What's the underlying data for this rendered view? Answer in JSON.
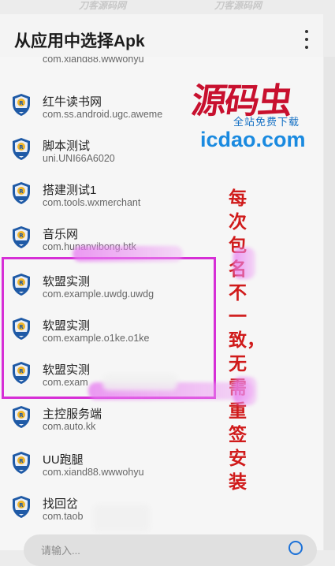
{
  "watermark_top": [
    "刀客源码网",
    "刀客源码网"
  ],
  "header": {
    "title": "从应用中选择Apk",
    "more_icon": "more-vert-icon"
  },
  "apps": [
    {
      "name": "",
      "package": "com.xiand88.wwwohyu",
      "icon": "wechat-icon"
    },
    {
      "name": "红牛读书网",
      "package": "com.ss.android.ugc.aweme",
      "icon": "ruanmeng-shield-icon"
    },
    {
      "name": "脚本测试",
      "package": "uni.UNI66A6020",
      "icon": "ruanmeng-shield-icon"
    },
    {
      "name": "搭建测试1",
      "package": "com.tools.wxmerchant",
      "icon": "ruanmeng-shield-icon"
    },
    {
      "name": "音乐网",
      "package": "com.hunanvibong.btk",
      "icon": "ruanmeng-shield-icon"
    },
    {
      "name": "软盟实测",
      "package": "com.example.uwdg.uwdg",
      "icon": "ruanmeng-shield-icon"
    },
    {
      "name": "软盟实测",
      "package": "com.example.o1ke.o1ke",
      "icon": "ruanmeng-shield-icon"
    },
    {
      "name": "软盟实测",
      "package": "com.exam",
      "icon": "ruanmeng-shield-icon"
    },
    {
      "name": "主控服务端",
      "package": "com.auto.kk",
      "icon": "ruanmeng-shield-icon"
    },
    {
      "name": "UU跑腿",
      "package": "com.xiand88.wwwohyu",
      "icon": "ruanmeng-shield-icon"
    },
    {
      "name": "找回岔",
      "package": "com.taob",
      "icon": "ruanmeng-shield-icon"
    }
  ],
  "overlay": {
    "logo_text": "源码虫",
    "logo_sub": "全站免费下载",
    "logo_url": "icdao.com",
    "vertical_note": "每次包名不一致，无需重签安装"
  },
  "search": {
    "placeholder": "请输入..."
  },
  "colors": {
    "accent": "#1d72d8",
    "highlight": "#d62fd6",
    "note_red": "#d01a1a"
  }
}
